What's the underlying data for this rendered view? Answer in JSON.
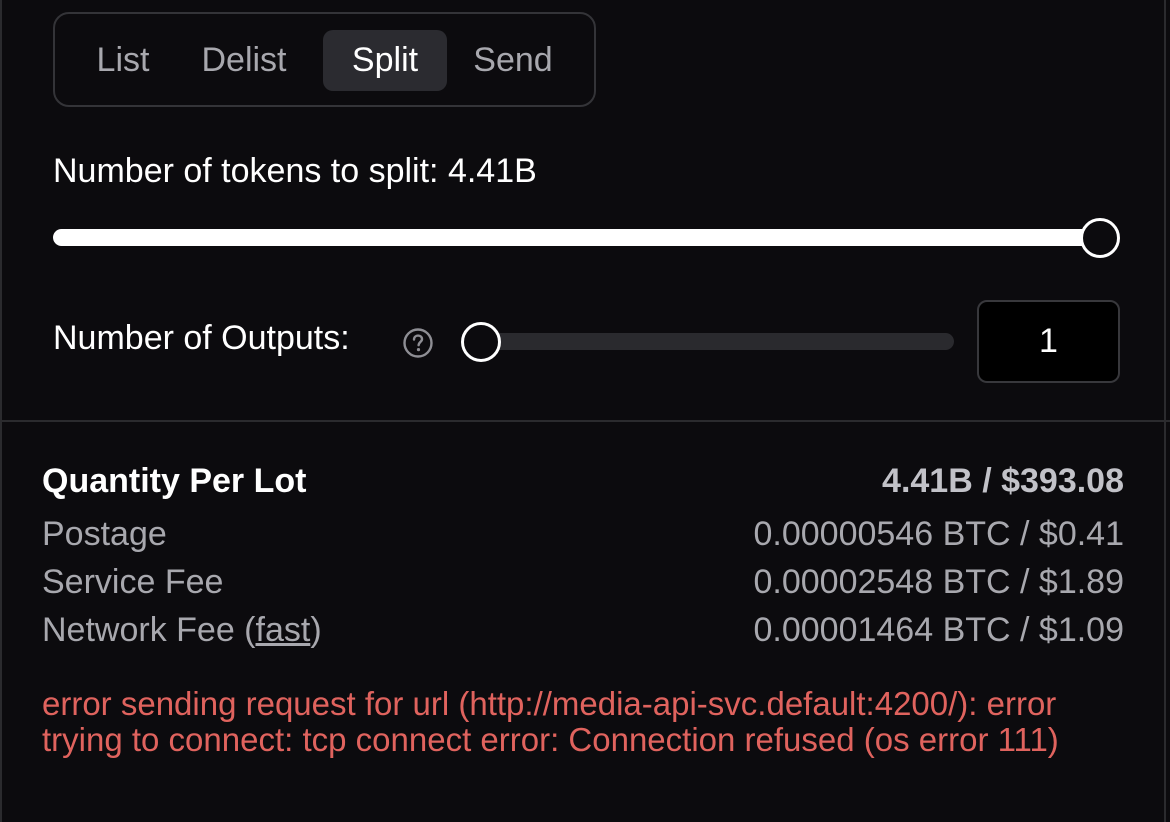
{
  "tabs": [
    {
      "label": "List",
      "active": false
    },
    {
      "label": "Delist",
      "active": false
    },
    {
      "label": "Split",
      "active": true
    },
    {
      "label": "Send",
      "active": false
    }
  ],
  "split": {
    "tokens_label": "Number of tokens to split: 4.41B",
    "tokens_slider_fraction": 1.0,
    "outputs_label": "Number of Outputs:",
    "outputs_help_icon": "question-circle-icon",
    "outputs_slider_fraction": 0.0,
    "outputs_value": "1"
  },
  "summary": {
    "quantity": {
      "label": "Quantity Per Lot",
      "value": "4.41B / $393.08"
    },
    "postage": {
      "label": "Postage",
      "value": "0.00000546 BTC / $0.41"
    },
    "service_fee": {
      "label": "Service Fee",
      "value": "0.00002548 BTC / $1.89"
    },
    "network_fee": {
      "label_prefix": "Network Fee (",
      "speed": "fast",
      "label_suffix": ")",
      "value": "0.00001464 BTC / $1.09"
    }
  },
  "error": {
    "message": "error sending request for url (http://media-api-svc.default:4200/): error trying to connect: tcp connect error: Connection refused (os error 111)"
  },
  "colors": {
    "background": "#0c0b0e",
    "error": "#e0635e",
    "muted_text": "#a8a8ae"
  }
}
